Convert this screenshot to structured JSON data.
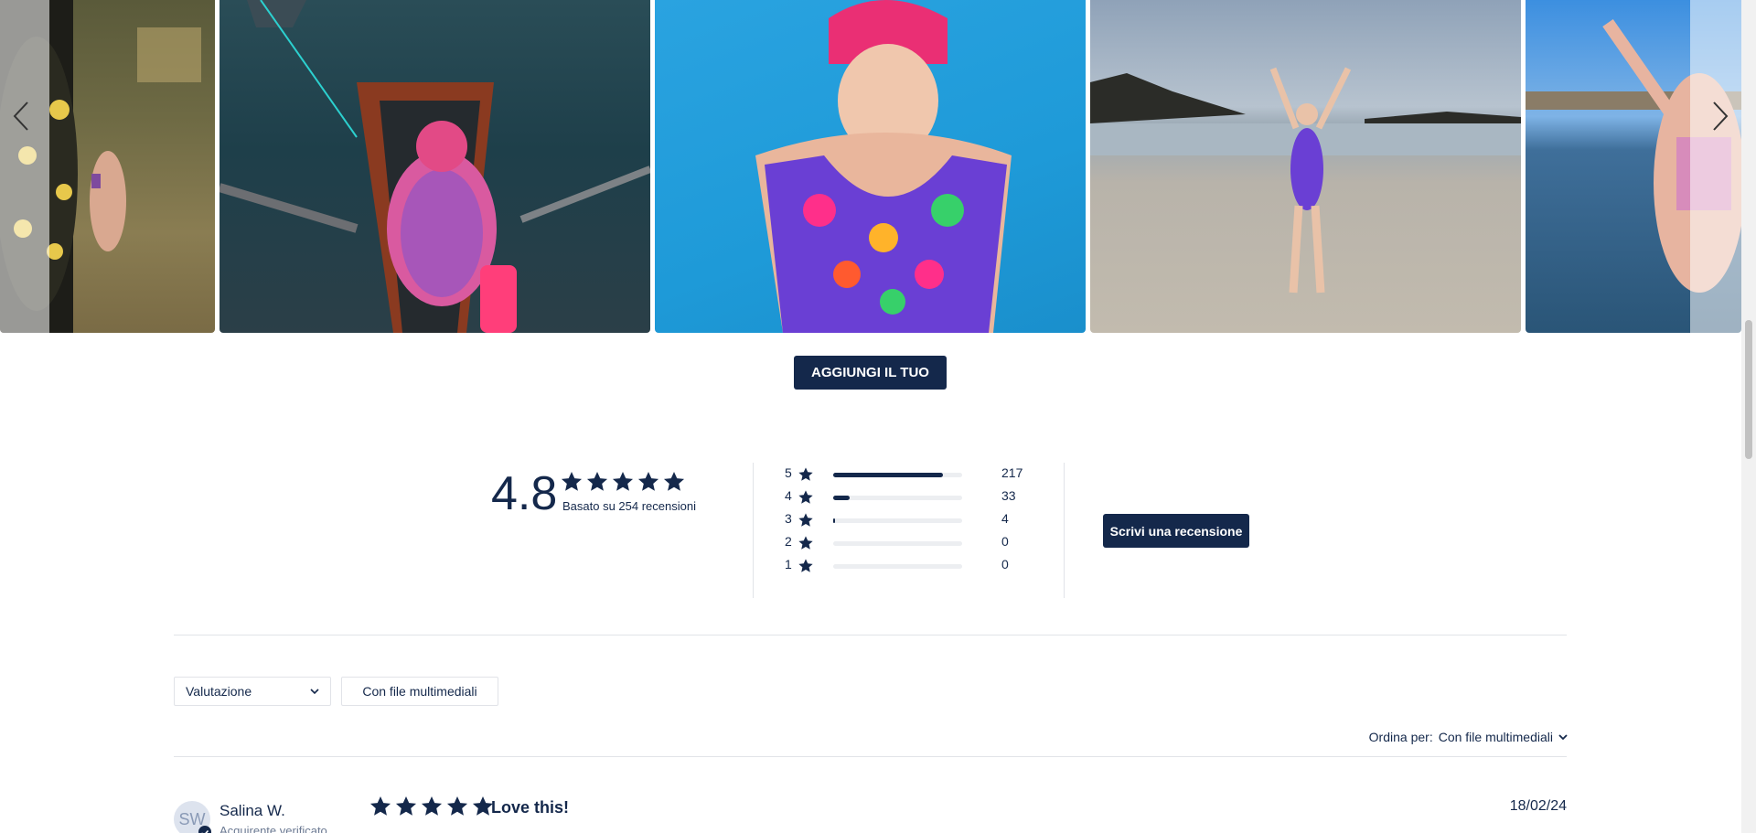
{
  "gallery": {
    "images": [
      {
        "alt": "photo-1"
      },
      {
        "alt": "photo-2"
      },
      {
        "alt": "photo-3"
      },
      {
        "alt": "photo-4"
      },
      {
        "alt": "photo-5"
      }
    ],
    "prev_icon": "chevron-left-icon",
    "next_icon": "chevron-right-icon"
  },
  "add_button_label": "AGGIUNGI IL TUO",
  "summary": {
    "average": "4.8",
    "average_stars": 5,
    "based_on": "Basato su 254 recensioni",
    "histogram": [
      {
        "rating": "5",
        "count": "217",
        "fraction": 0.854
      },
      {
        "rating": "4",
        "count": "33",
        "fraction": 0.13
      },
      {
        "rating": "3",
        "count": "4",
        "fraction": 0.016
      },
      {
        "rating": "2",
        "count": "0",
        "fraction": 0
      },
      {
        "rating": "1",
        "count": "0",
        "fraction": 0
      }
    ],
    "write_review_label": "Scrivi una recensione"
  },
  "filters": {
    "rating_select": "Valutazione",
    "media_chip": "Con file multimediali"
  },
  "sort": {
    "label": "Ordina per:",
    "value": "Con file multimediali"
  },
  "review": {
    "initials": "SW",
    "name": "Salina W.",
    "verified": "Acquirente verificato",
    "stars": 5,
    "title": "Love this!",
    "date": "18/02/24"
  },
  "colors": {
    "brand": "#14284b",
    "divider": "#e1e3e8"
  }
}
